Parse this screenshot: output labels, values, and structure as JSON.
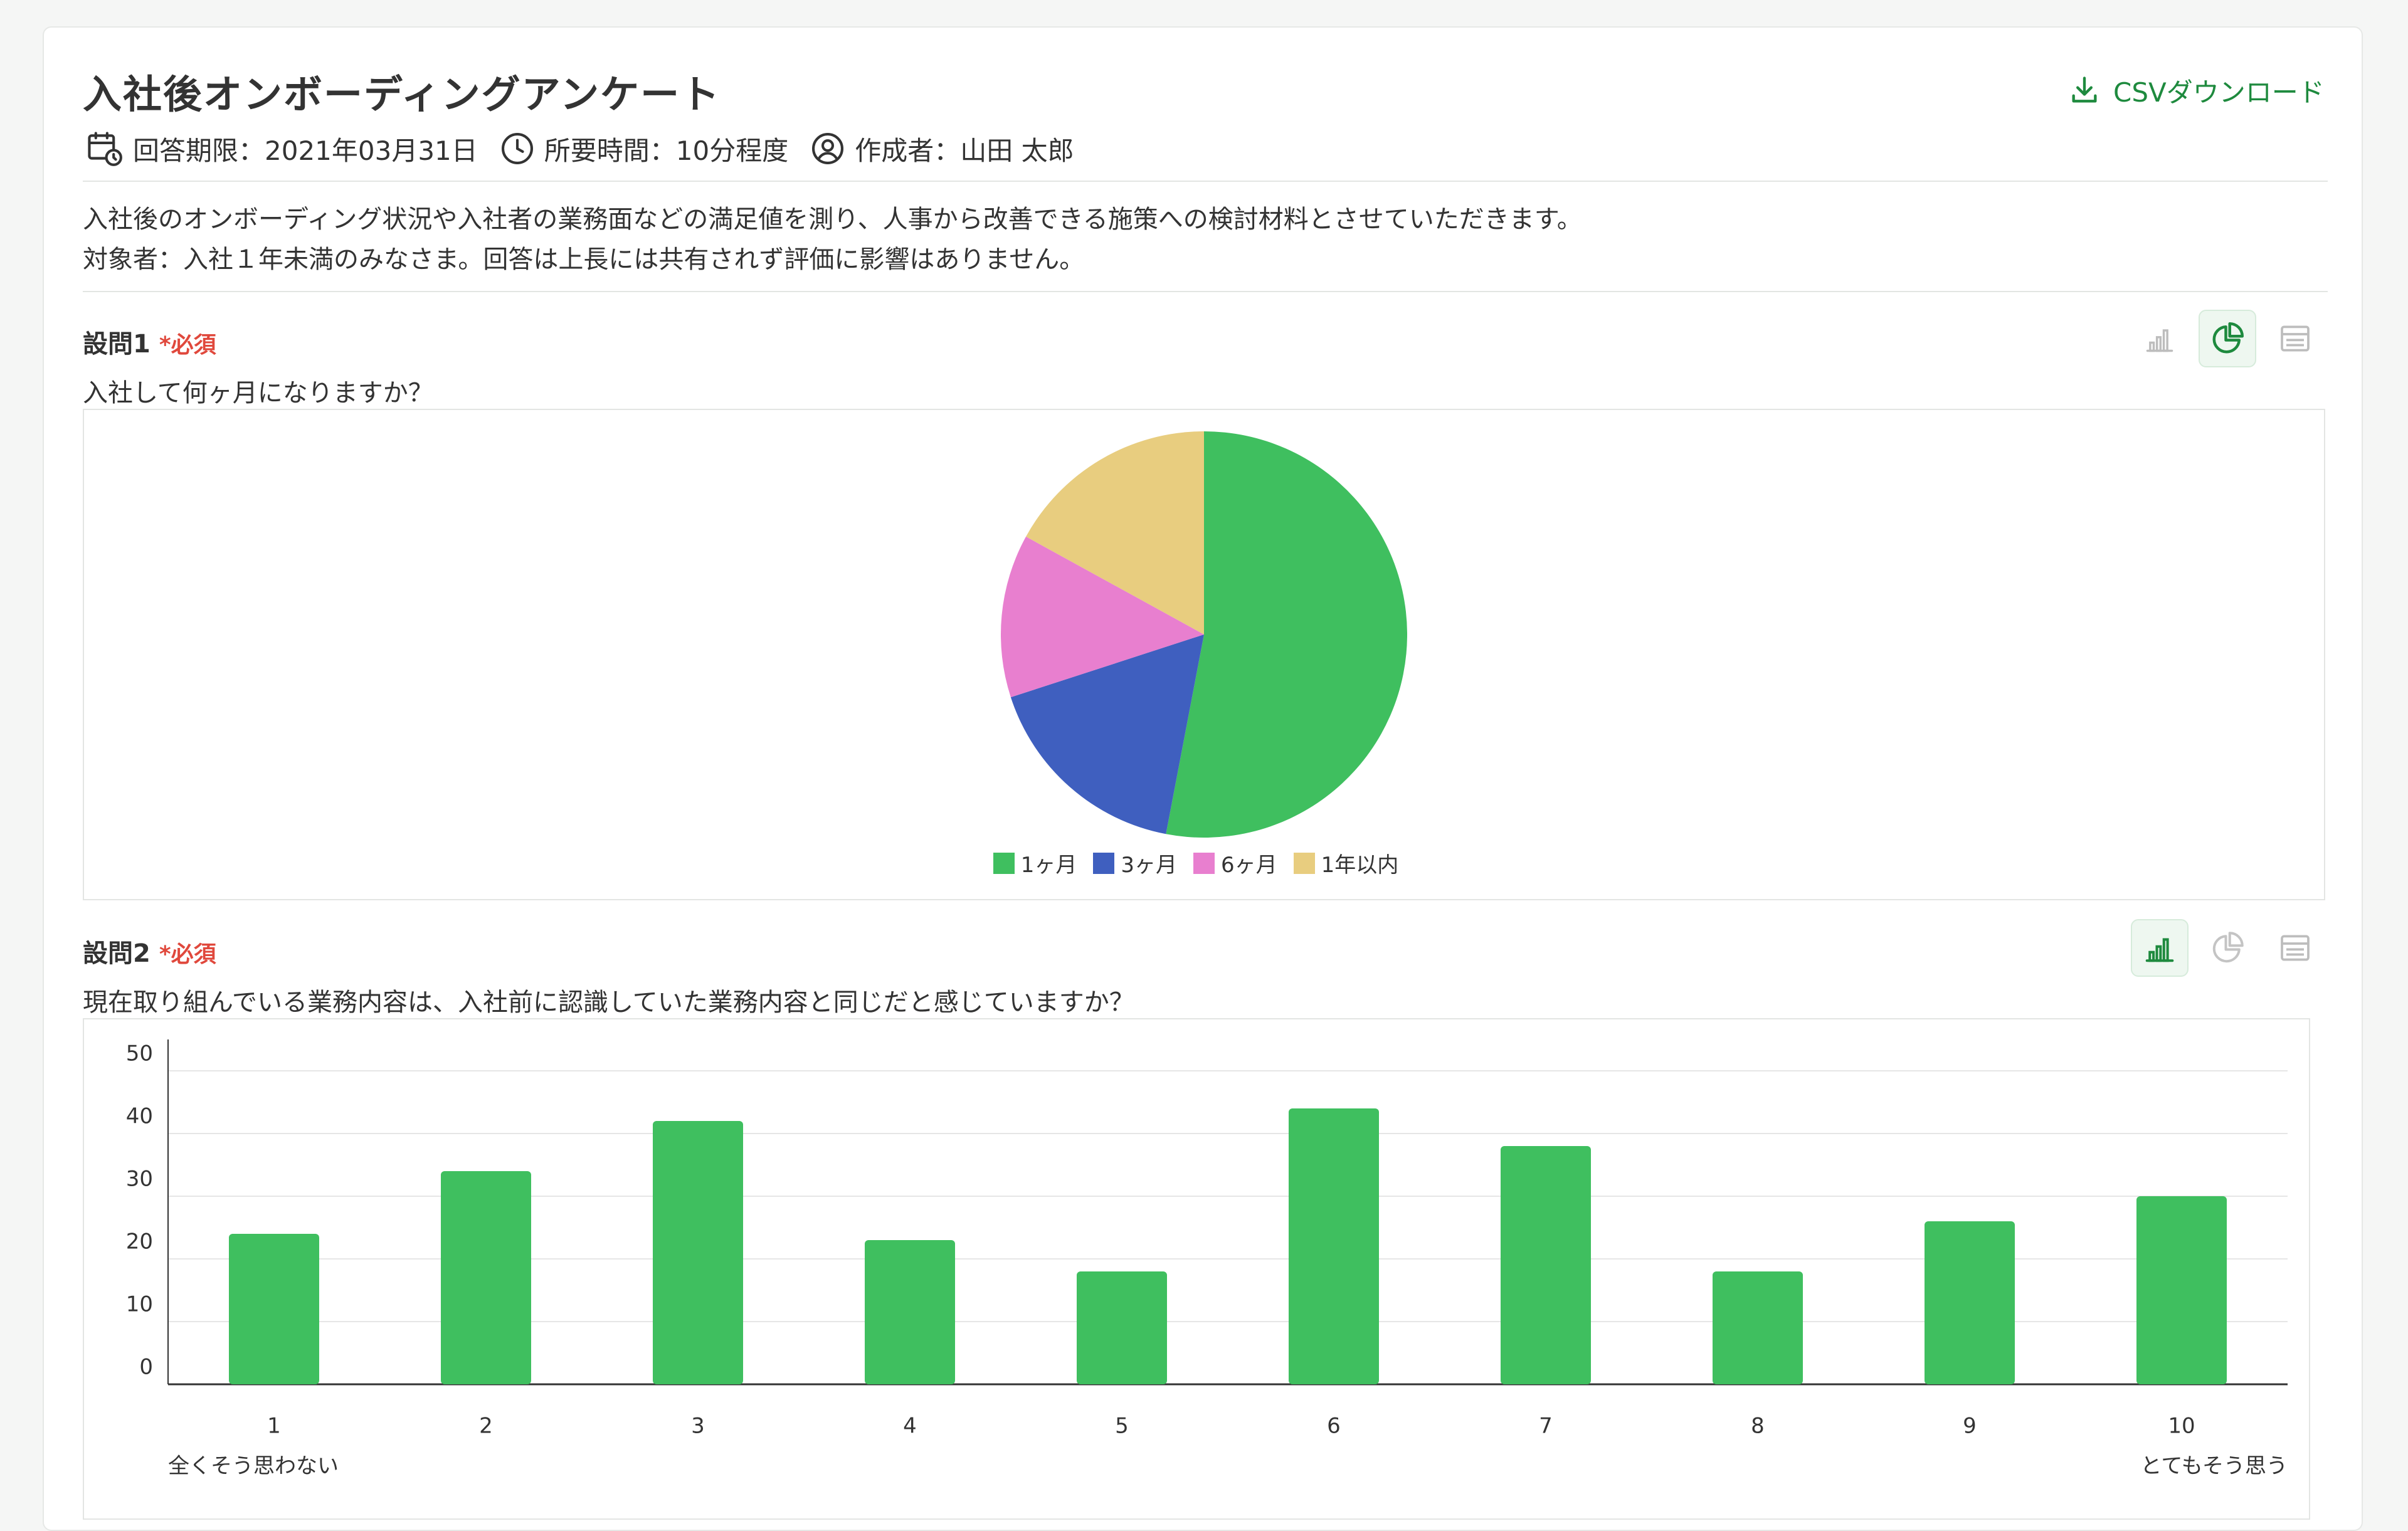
{
  "survey": {
    "title": "入社後オンボーディングアンケート",
    "csv_label": "CSVダウンロード",
    "deadline": "回答期限：2021年03月31日",
    "duration": "所要時間：10分程度",
    "author": "作成者：山田 太郎",
    "description_line1": "入社後のオンボーディング状況や入社者の業務面などの満足値を測り、人事から改善できる施策への検討材料とさせていただきます。",
    "description_line2": "対象者：入社１年未満のみなさま。回答は上長には共有されず評価に影響はありません。"
  },
  "colors": {
    "accent": "#1e8a3e",
    "required": "#e0483c",
    "bar": "#3fbf5f"
  },
  "questions": [
    {
      "label": "設問1",
      "required": "*必須",
      "text": "入社して何ヶ月になりますか？",
      "active_view": "pie"
    },
    {
      "label": "設問2",
      "required": "*必須",
      "text": "現在取り組んでいる業務内容は、入社前に認識していた業務内容と同じだと感じていますか？",
      "active_view": "bar",
      "scale_low_label": "全くそう思わない",
      "scale_high_label": "とてもそう思う"
    }
  ],
  "chart_data": [
    {
      "type": "pie",
      "categories": [
        "1ヶ月",
        "3ヶ月",
        "6ヶ月",
        "1年以内"
      ],
      "values": [
        53,
        17,
        13,
        17
      ],
      "colors": [
        "#3fbf5f",
        "#3f5fbf",
        "#e87fcf",
        "#e8cd7f"
      ],
      "legend": "bottom"
    },
    {
      "type": "bar",
      "categories": [
        "1",
        "2",
        "3",
        "4",
        "5",
        "6",
        "7",
        "8",
        "9",
        "10"
      ],
      "values": [
        24,
        34,
        42,
        23,
        18,
        44,
        38,
        18,
        26,
        30
      ],
      "ylim": [
        0,
        55
      ],
      "yticks": [
        0,
        10,
        20,
        30,
        40,
        50
      ],
      "color": "#3fbf5f",
      "grid": true
    }
  ]
}
